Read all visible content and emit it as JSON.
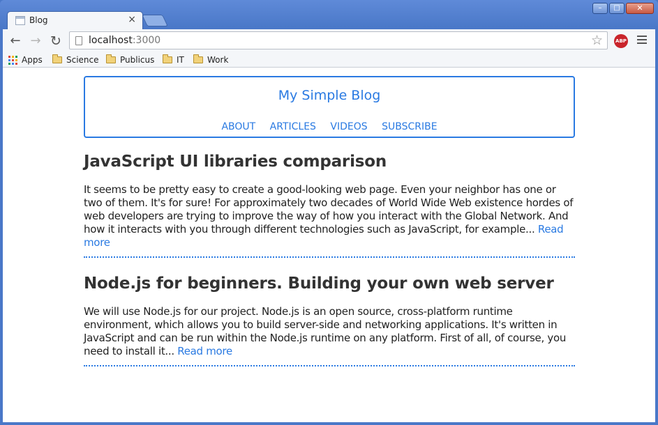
{
  "browser": {
    "tab_title": "Blog",
    "tab_close": "×",
    "url_host": "localhost",
    "url_port": ":3000",
    "abp_label": "ABP",
    "icons": {
      "back": "arrow-left-icon",
      "forward": "arrow-right-icon",
      "reload": "reload-icon",
      "star": "star-icon",
      "menu": "hamburger-menu-icon"
    },
    "window_controls": {
      "minimize": "–",
      "maximize": "□",
      "close": "✕"
    }
  },
  "bookmarks": [
    {
      "label": "Apps",
      "icon": "apps-grid-icon"
    },
    {
      "label": "Science",
      "icon": "folder-icon"
    },
    {
      "label": "Publicus",
      "icon": "folder-icon"
    },
    {
      "label": "IT",
      "icon": "folder-icon"
    },
    {
      "label": "Work",
      "icon": "folder-icon"
    }
  ],
  "blog": {
    "title": "My Simple Blog",
    "nav": [
      "ABOUT",
      "ARTICLES",
      "VIDEOS",
      "SUBSCRIBE"
    ],
    "accent_color": "#2a7ae2",
    "posts": [
      {
        "title": "JavaScript UI libraries comparison",
        "excerpt": "It seems to be pretty easy to create a good-looking web page. Even your neighbor has one or two of them. It's for sure! For approximately two decades of World Wide Web existence hordes of web developers are trying to improve the way of how you interact with the Global Network. And how it interacts with you through different technologies such as JavaScript, for example...",
        "read_more": "Read more"
      },
      {
        "title": "Node.js for beginners. Building your own web server",
        "excerpt": "We will use Node.js for our project. Node.js is an open source, cross-platform runtime environment, which allows you to build server-side and networking applications. It's written in JavaScript and can be run within the Node.js runtime on any platform. First of all, of course, you need to install it...",
        "read_more": "Read more"
      }
    ]
  }
}
